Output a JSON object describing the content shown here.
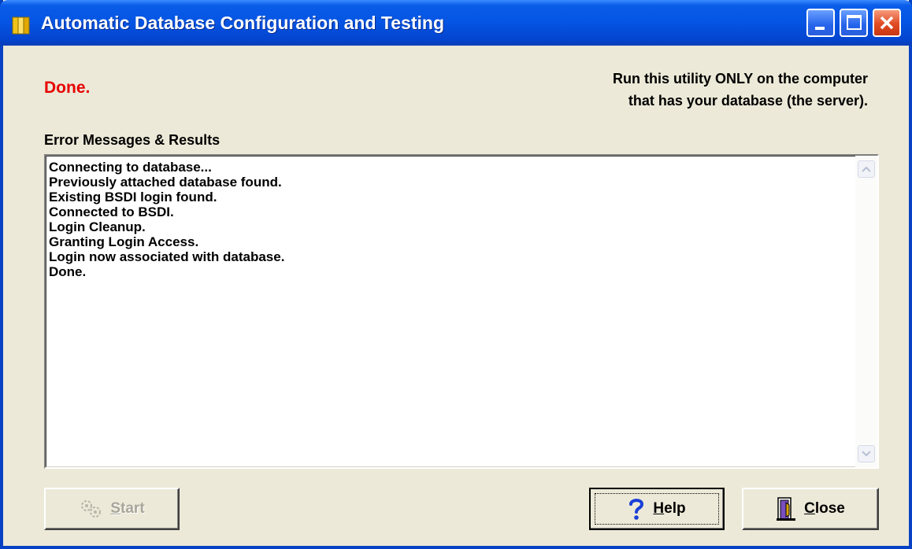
{
  "window": {
    "title": "Automatic Database Configuration and Testing"
  },
  "status_text": "Done.",
  "warning_lines": [
    "Run this utility ONLY on the computer",
    "that has your database (the server)."
  ],
  "results": {
    "label": "Error Messages & Results",
    "lines": [
      "Connecting to database...",
      "Previously attached database found.",
      "Existing BSDI login found.",
      "Connected to BSDI.",
      "Login Cleanup.",
      "Granting Login Access.",
      "Login now associated with database.",
      "Done."
    ]
  },
  "buttons": {
    "start": {
      "label": "Start",
      "hotkey": "S",
      "rest": "tart",
      "icon": "gears-icon",
      "enabled": false
    },
    "help": {
      "label": "Help",
      "hotkey": "H",
      "rest": "elp",
      "icon": "question-mark-icon",
      "focused": true
    },
    "close": {
      "label": "Close",
      "hotkey": "C",
      "rest": "lose",
      "icon": "exit-door-icon"
    }
  },
  "colors": {
    "title_bar": "#0554e3",
    "status": "#e60000",
    "face": "#ece9d8"
  }
}
